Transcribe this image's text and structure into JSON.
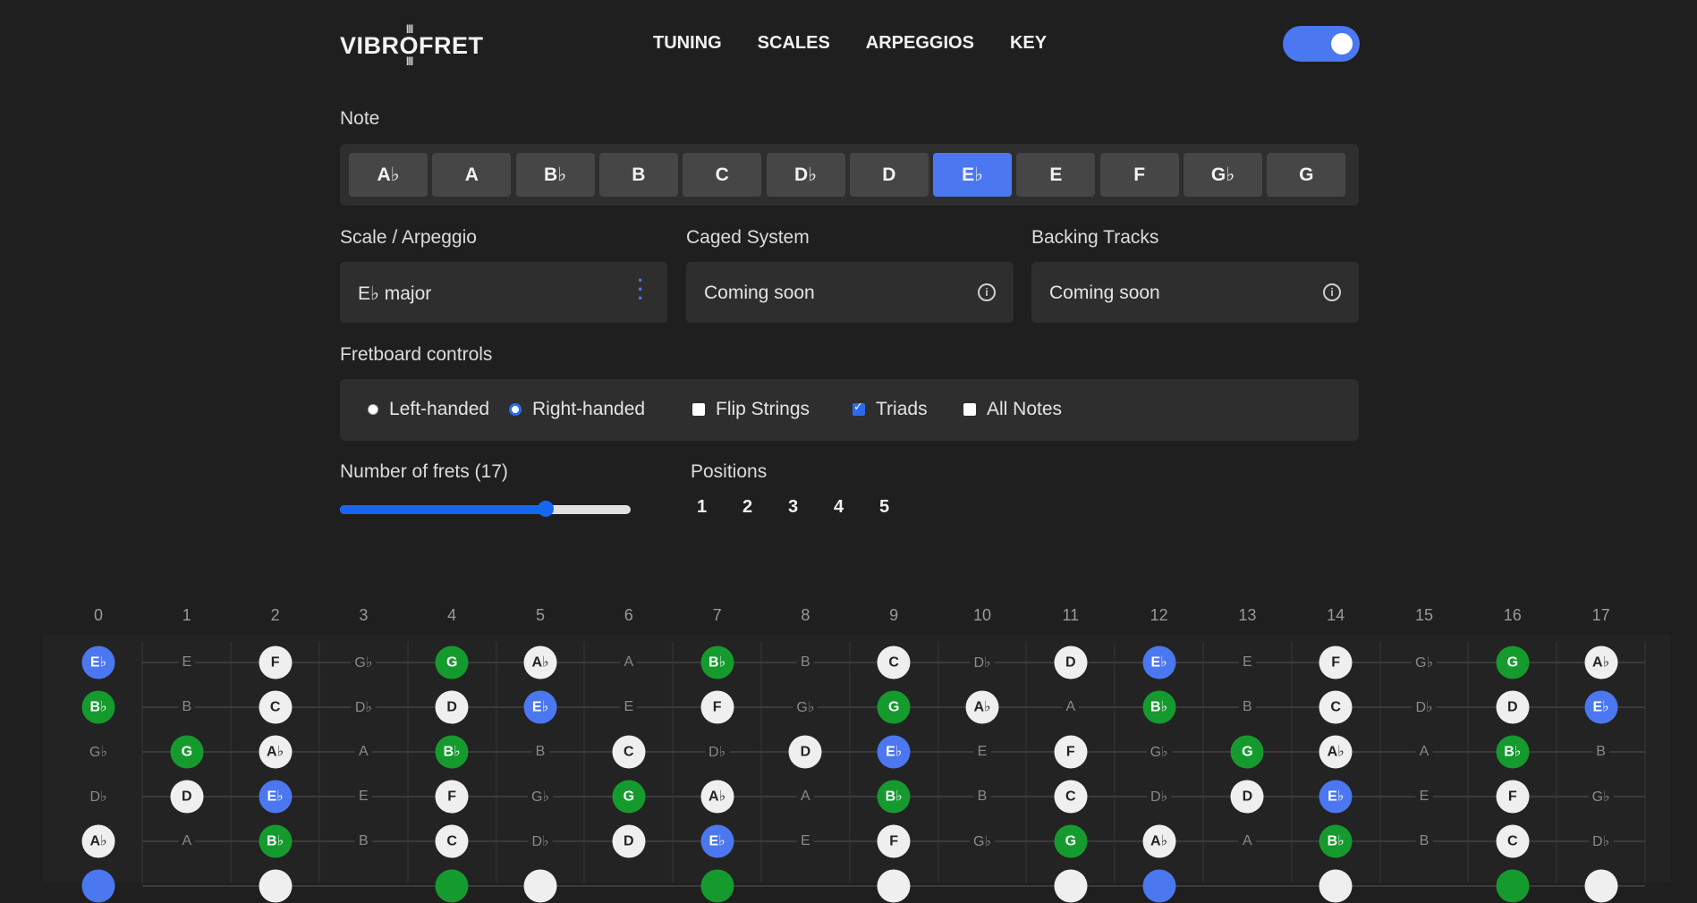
{
  "header": {
    "logo": "VIBROFRET",
    "logo_bars_top": "||||",
    "logo_bars_bottom": "||||",
    "nav": [
      "TUNING",
      "SCALES",
      "ARPEGGIOS",
      "KEY"
    ]
  },
  "note_section": {
    "label": "Note",
    "notes": [
      "A♭",
      "A",
      "B♭",
      "B",
      "C",
      "D♭",
      "D",
      "E♭",
      "E",
      "F",
      "G♭",
      "G"
    ],
    "selected_index": 7
  },
  "scale": {
    "label": "Scale / Arpeggio",
    "value": "E♭ major"
  },
  "caged": {
    "label": "Caged System",
    "value": "Coming soon"
  },
  "backing": {
    "label": "Backing Tracks",
    "value": "Coming soon"
  },
  "info_glyph": "i",
  "fretboard_controls": {
    "label": "Fretboard controls",
    "left_handed": "Left-handed",
    "right_handed": "Right-handed",
    "flip_strings": "Flip Strings",
    "triads": "Triads",
    "all_notes": "All Notes",
    "handedness": "right",
    "flip_checked": false,
    "triads_checked": true,
    "all_notes_checked": false
  },
  "frets_control": {
    "label": "Number of frets (17)",
    "value": 17,
    "min": 0,
    "max": 24
  },
  "positions": {
    "label": "Positions",
    "items": [
      "1",
      "2",
      "3",
      "4",
      "5"
    ]
  },
  "fretboard": {
    "fret_numbers": [
      "0",
      "1",
      "2",
      "3",
      "4",
      "5",
      "6",
      "7",
      "8",
      "9",
      "10",
      "11",
      "12",
      "13",
      "14",
      "15",
      "16",
      "17"
    ],
    "strings": [
      [
        [
          "E♭",
          "b"
        ],
        [
          "E",
          "d"
        ],
        [
          "F",
          "w"
        ],
        [
          "G♭",
          "d"
        ],
        [
          "G",
          "g"
        ],
        [
          "A♭",
          "w"
        ],
        [
          "A",
          "d"
        ],
        [
          "B♭",
          "g"
        ],
        [
          "B",
          "d"
        ],
        [
          "C",
          "w"
        ],
        [
          "D♭",
          "d"
        ],
        [
          "D",
          "w"
        ],
        [
          "E♭",
          "b"
        ],
        [
          "E",
          "d"
        ],
        [
          "F",
          "w"
        ],
        [
          "G♭",
          "d"
        ],
        [
          "G",
          "g"
        ],
        [
          "A♭",
          "w"
        ]
      ],
      [
        [
          "B♭",
          "g"
        ],
        [
          "B",
          "d"
        ],
        [
          "C",
          "w"
        ],
        [
          "D♭",
          "d"
        ],
        [
          "D",
          "w"
        ],
        [
          "E♭",
          "b"
        ],
        [
          "E",
          "d"
        ],
        [
          "F",
          "w"
        ],
        [
          "G♭",
          "d"
        ],
        [
          "G",
          "g"
        ],
        [
          "A♭",
          "w"
        ],
        [
          "A",
          "d"
        ],
        [
          "B♭",
          "g"
        ],
        [
          "B",
          "d"
        ],
        [
          "C",
          "w"
        ],
        [
          "D♭",
          "d"
        ],
        [
          "D",
          "w"
        ],
        [
          "E♭",
          "b"
        ]
      ],
      [
        [
          "G♭",
          "d"
        ],
        [
          "G",
          "g"
        ],
        [
          "A♭",
          "w"
        ],
        [
          "A",
          "d"
        ],
        [
          "B♭",
          "g"
        ],
        [
          "B",
          "d"
        ],
        [
          "C",
          "w"
        ],
        [
          "D♭",
          "d"
        ],
        [
          "D",
          "w"
        ],
        [
          "E♭",
          "b"
        ],
        [
          "E",
          "d"
        ],
        [
          "F",
          "w"
        ],
        [
          "G♭",
          "d"
        ],
        [
          "G",
          "g"
        ],
        [
          "A♭",
          "w"
        ],
        [
          "A",
          "d"
        ],
        [
          "B♭",
          "g"
        ],
        [
          "B",
          "d"
        ]
      ],
      [
        [
          "D♭",
          "d"
        ],
        [
          "D",
          "w"
        ],
        [
          "E♭",
          "b"
        ],
        [
          "E",
          "d"
        ],
        [
          "F",
          "w"
        ],
        [
          "G♭",
          "d"
        ],
        [
          "G",
          "g"
        ],
        [
          "A♭",
          "w"
        ],
        [
          "A",
          "d"
        ],
        [
          "B♭",
          "g"
        ],
        [
          "B",
          "d"
        ],
        [
          "C",
          "w"
        ],
        [
          "D♭",
          "d"
        ],
        [
          "D",
          "w"
        ],
        [
          "E♭",
          "b"
        ],
        [
          "E",
          "d"
        ],
        [
          "F",
          "w"
        ],
        [
          "G♭",
          "d"
        ]
      ],
      [
        [
          "A♭",
          "w"
        ],
        [
          "A",
          "d"
        ],
        [
          "B♭",
          "g"
        ],
        [
          "B",
          "d"
        ],
        [
          "C",
          "w"
        ],
        [
          "D♭",
          "d"
        ],
        [
          "D",
          "w"
        ],
        [
          "E♭",
          "b"
        ],
        [
          "E",
          "d"
        ],
        [
          "F",
          "w"
        ],
        [
          "G♭",
          "d"
        ],
        [
          "G",
          "g"
        ],
        [
          "A♭",
          "w"
        ],
        [
          "A",
          "d"
        ],
        [
          "B♭",
          "g"
        ],
        [
          "B",
          "d"
        ],
        [
          "C",
          "w"
        ],
        [
          "D♭",
          "d"
        ]
      ]
    ],
    "partial_string": [
      "b",
      "",
      "w",
      "",
      "g",
      "w",
      "",
      "g",
      "",
      "w",
      "",
      "w",
      "b",
      "",
      "w",
      "",
      "g",
      "w"
    ]
  },
  "colors": {
    "accent": "#4b77f0",
    "green": "#159a2e",
    "background": "#1f1f1f",
    "panel": "#2e2e2e"
  }
}
